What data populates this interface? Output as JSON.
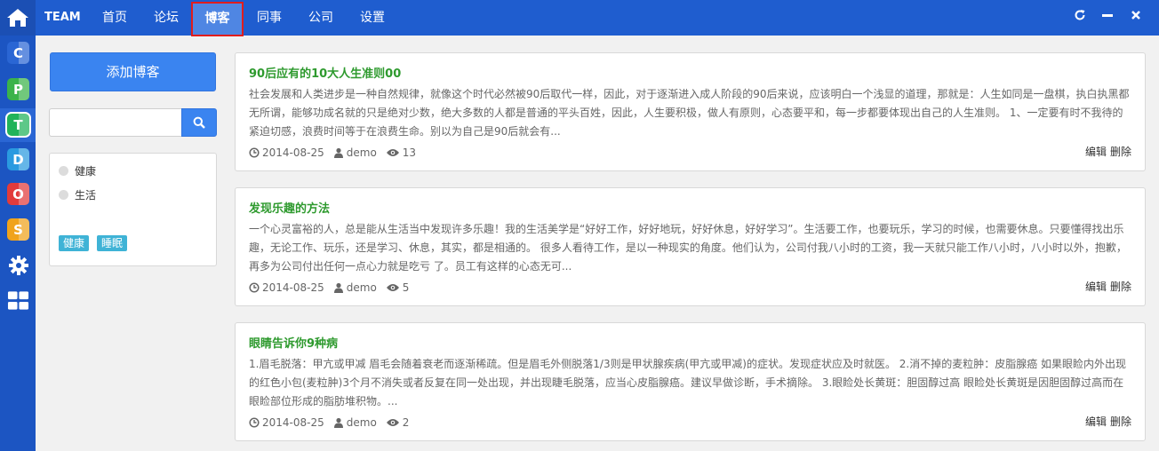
{
  "brand": "TEAM",
  "nav": [
    {
      "label": "首页"
    },
    {
      "label": "论坛"
    },
    {
      "label": "博客",
      "active": true
    },
    {
      "label": "同事"
    },
    {
      "label": "公司"
    },
    {
      "label": "设置"
    }
  ],
  "rail": [
    {
      "letter": "C",
      "color": "#2a66d4",
      "name": "app-c"
    },
    {
      "letter": "P",
      "color": "#3bb34a",
      "name": "app-p"
    },
    {
      "letter": "T",
      "color": "#21b35a",
      "name": "app-t"
    },
    {
      "letter": "D",
      "color": "#2a9ae0",
      "name": "app-d"
    },
    {
      "letter": "O",
      "color": "#e23b3b",
      "name": "app-o"
    },
    {
      "letter": "S",
      "color": "#f0a31c",
      "name": "app-s"
    }
  ],
  "sidebar": {
    "add_label": "添加博客",
    "search_placeholder": "",
    "categories": [
      "健康",
      "生活"
    ],
    "tags": [
      "健康",
      "睡眠"
    ]
  },
  "posts": [
    {
      "title": "90后应有的10大人生准则00",
      "excerpt": "社会发展和人类进步是一种自然规律，就像这个时代必然被90后取代一样，因此，对于逐渐进入成人阶段的90后来说，应该明白一个浅显的道理，那就是：人生如同是一盘棋，执白执黑都无所谓，能够功成名就的只是绝对少数，绝大多数的人都是普通的平头百姓，因此，人生要积极，做人有原则，心态要平和，每一步都要体现出自己的人生准则。 1、一定要有时不我待的紧迫切感，浪费时间等于在浪费生命。别以为自己是90后就会有...",
      "date": "2014-08-25",
      "author": "demo",
      "views": "13"
    },
    {
      "title": "发现乐趣的方法",
      "excerpt": "一个心灵富裕的人，总是能从生活当中发现许多乐趣！我的生活美学是“好好工作，好好地玩，好好休息，好好学习”。生活要工作，也要玩乐，学习的时候，也需要休息。只要懂得找出乐趣，无论工作、玩乐，还是学习、休息，其实，都是相通的。 很多人看待工作，是以一种现实的角度。他们认为，公司付我八小时的工资，我一天就只能工作八小时，八小时以外，抱歉，再多为公司付出任何一点心力就是吃亏 了。员工有这样的心态无可...",
      "date": "2014-08-25",
      "author": "demo",
      "views": "5"
    },
    {
      "title": "眼睛告诉你9种病",
      "excerpt": "1.眉毛脱落：甲亢或甲减 眉毛会随着衰老而逐渐稀疏。但是眉毛外侧脱落1/3则是甲状腺疾病(甲亢或甲减)的症状。发现症状应及时就医。 2.消不掉的麦粒肿：皮脂腺癌 如果眼睑内外出现的红色小包(麦粒肿)3个月不消失或者反复在同一处出现，并出现睫毛脱落，应当心皮脂腺癌。建议早做诊断，手术摘除。 3.眼睑处长黄斑：胆固醇过高 眼睑处长黄斑是因胆固醇过高而在眼睑部位形成的脂肪堆积物。...",
      "date": "2014-08-25",
      "author": "demo",
      "views": "2"
    }
  ],
  "actions": {
    "edit": "编辑",
    "delete": "删除"
  }
}
